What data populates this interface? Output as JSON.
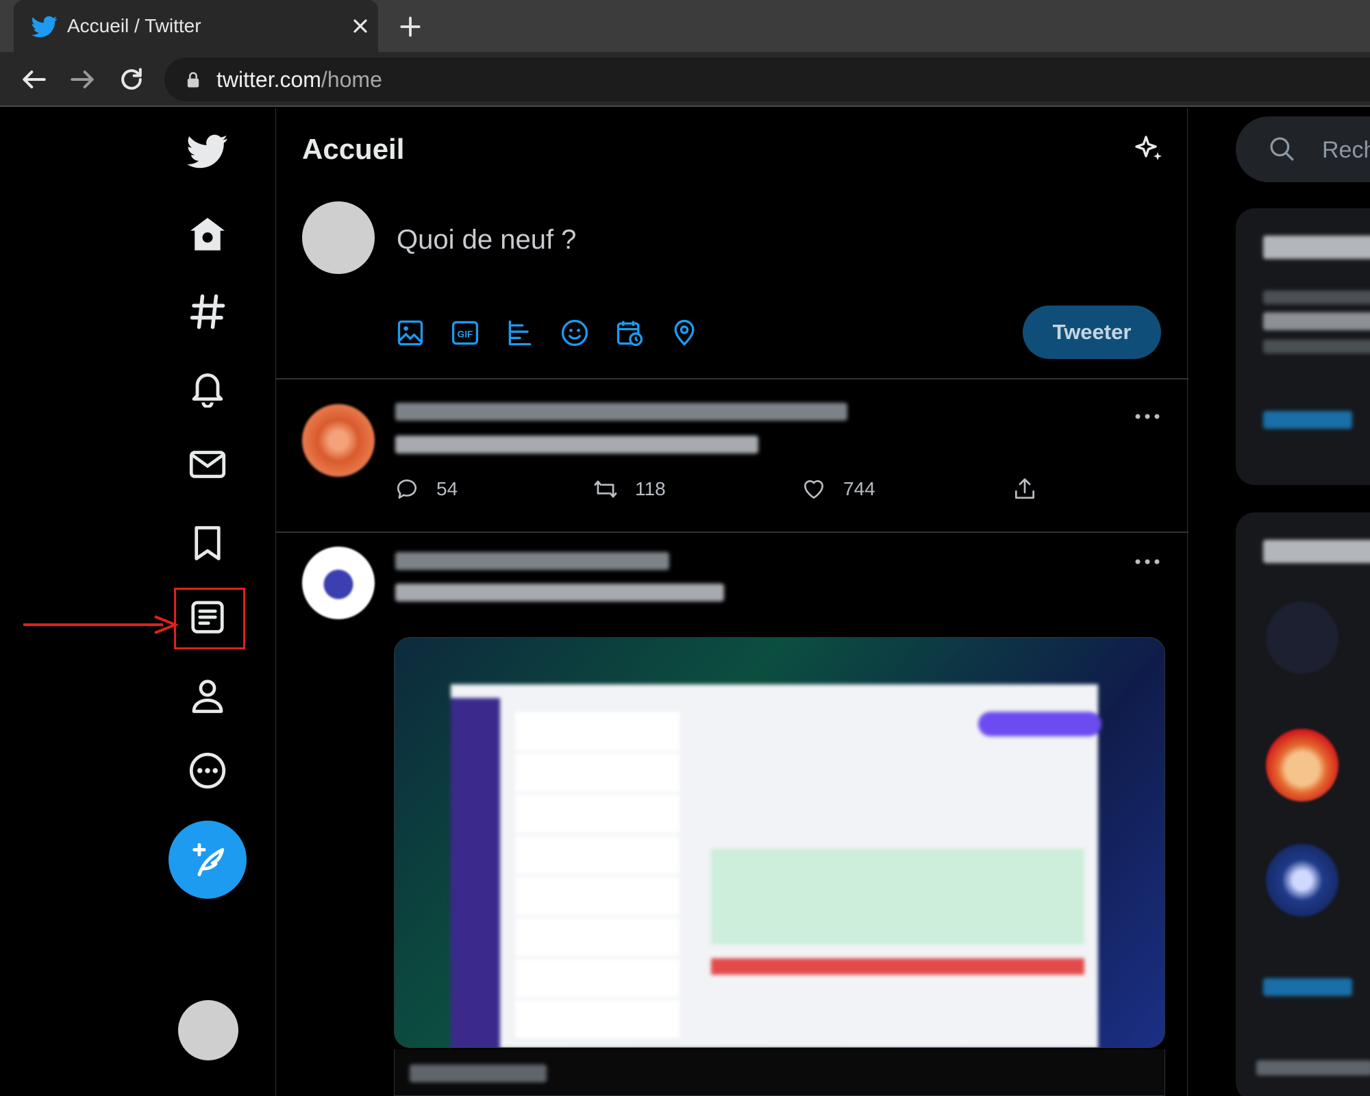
{
  "browser": {
    "tab_title": "Accueil / Twitter",
    "url_domain": "twitter.com",
    "url_path": "/home"
  },
  "sidebar": {
    "items": [
      {
        "name": "home",
        "icon": "home-icon"
      },
      {
        "name": "explore",
        "icon": "hashtag-icon"
      },
      {
        "name": "notifications",
        "icon": "bell-icon"
      },
      {
        "name": "messages",
        "icon": "envelope-icon"
      },
      {
        "name": "bookmarks",
        "icon": "bookmark-icon"
      },
      {
        "name": "lists",
        "icon": "lists-icon",
        "highlighted": true
      },
      {
        "name": "profile",
        "icon": "person-icon"
      },
      {
        "name": "more",
        "icon": "more-circle-icon"
      }
    ],
    "annotation_color": "#e02020"
  },
  "main": {
    "title": "Accueil",
    "composer": {
      "placeholder": "Quoi de neuf ?",
      "tweet_label": "Tweeter"
    },
    "tweets": [
      {
        "replies": "54",
        "retweets": "118",
        "likes": "744"
      }
    ]
  },
  "right": {
    "search_placeholder": "Rech"
  },
  "colors": {
    "accent": "#1d9bf0",
    "background": "#000000",
    "tweet_button": "#0f4e79"
  }
}
